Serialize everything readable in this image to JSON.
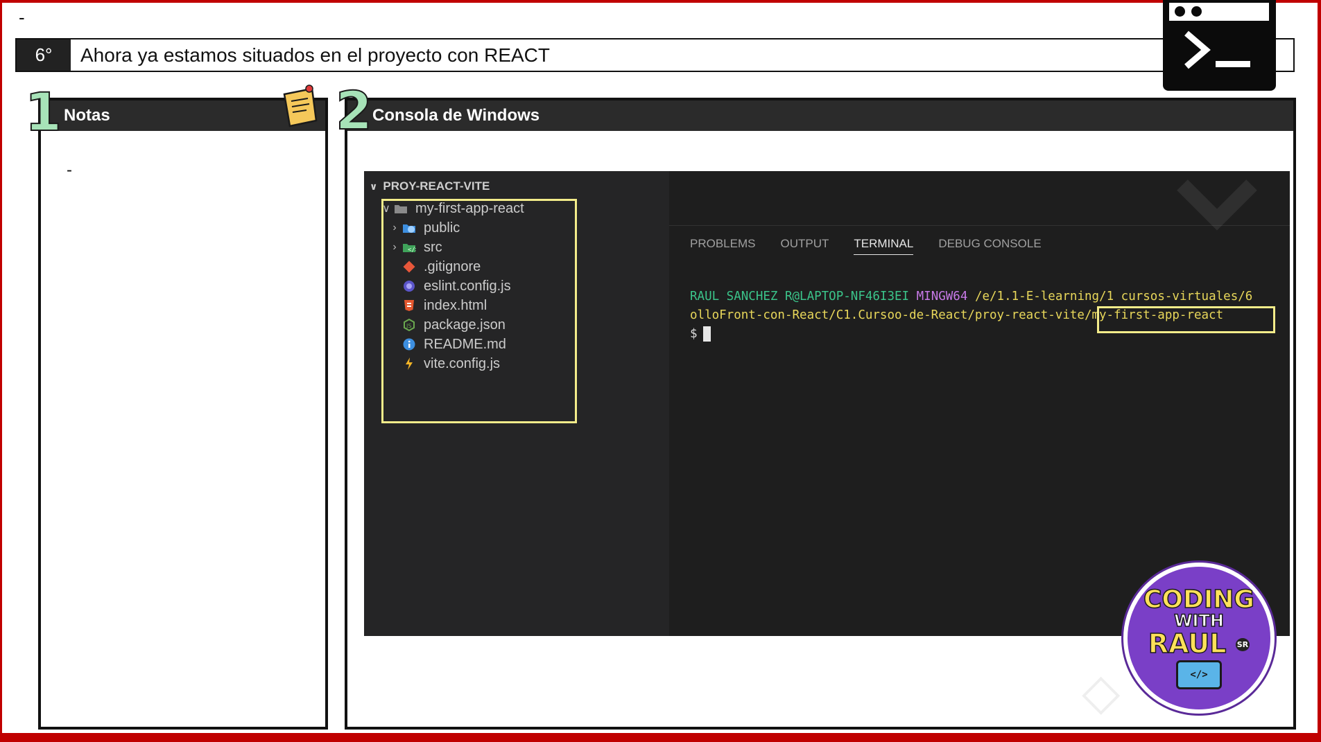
{
  "page": {
    "top_dash": "-",
    "step": {
      "number": "6°",
      "text": "Ahora ya estamos situados en el proyecto con REACT"
    }
  },
  "notes_panel": {
    "index": "1",
    "title": "Notas",
    "content": "-"
  },
  "console_panel": {
    "index": "2",
    "title": "Consola de Windows"
  },
  "explorer": {
    "root": "PROY-REACT-VITE",
    "items": [
      {
        "label": "my-first-app-react",
        "icon": "folder-open-icon",
        "chevron": "open"
      },
      {
        "label": "public",
        "icon": "globe-folder-icon",
        "chevron": "closed"
      },
      {
        "label": "src",
        "icon": "code-folder-icon",
        "chevron": "closed"
      },
      {
        "label": ".gitignore",
        "icon": "git-icon",
        "chevron": "none"
      },
      {
        "label": "eslint.config.js",
        "icon": "eslint-icon",
        "chevron": "none"
      },
      {
        "label": "index.html",
        "icon": "html5-icon",
        "chevron": "none"
      },
      {
        "label": "package.json",
        "icon": "node-icon",
        "chevron": "none"
      },
      {
        "label": "README.md",
        "icon": "info-icon",
        "chevron": "none"
      },
      {
        "label": "vite.config.js",
        "icon": "vite-icon",
        "chevron": "none"
      }
    ]
  },
  "terminal": {
    "tabs": [
      "PROBLEMS",
      "OUTPUT",
      "TERMINAL",
      "DEBUG CONSOLE"
    ],
    "active_tab": "TERMINAL",
    "user_host": "RAUL SANCHEZ R@LAPTOP-NF46I3EI",
    "shell": "MINGW64",
    "path_line1": "/e/1.1-E-learning/1 cursos-virtuales/6",
    "path_line2": "olloFront-con-React/C1.Cursoo-de-React/proy-react-vite/my-first-app-react",
    "prompt": "$"
  },
  "brand": {
    "line1": "CODING",
    "line2": "WITH",
    "line3": "RAUL",
    "badge": "SR",
    "window_text": "</>"
  },
  "colors": {
    "frame": "#c00000",
    "highlight": "#f3ec8a",
    "user_host": "#3bc48a",
    "shell": "#c87ae8",
    "path": "#e8d75a"
  }
}
